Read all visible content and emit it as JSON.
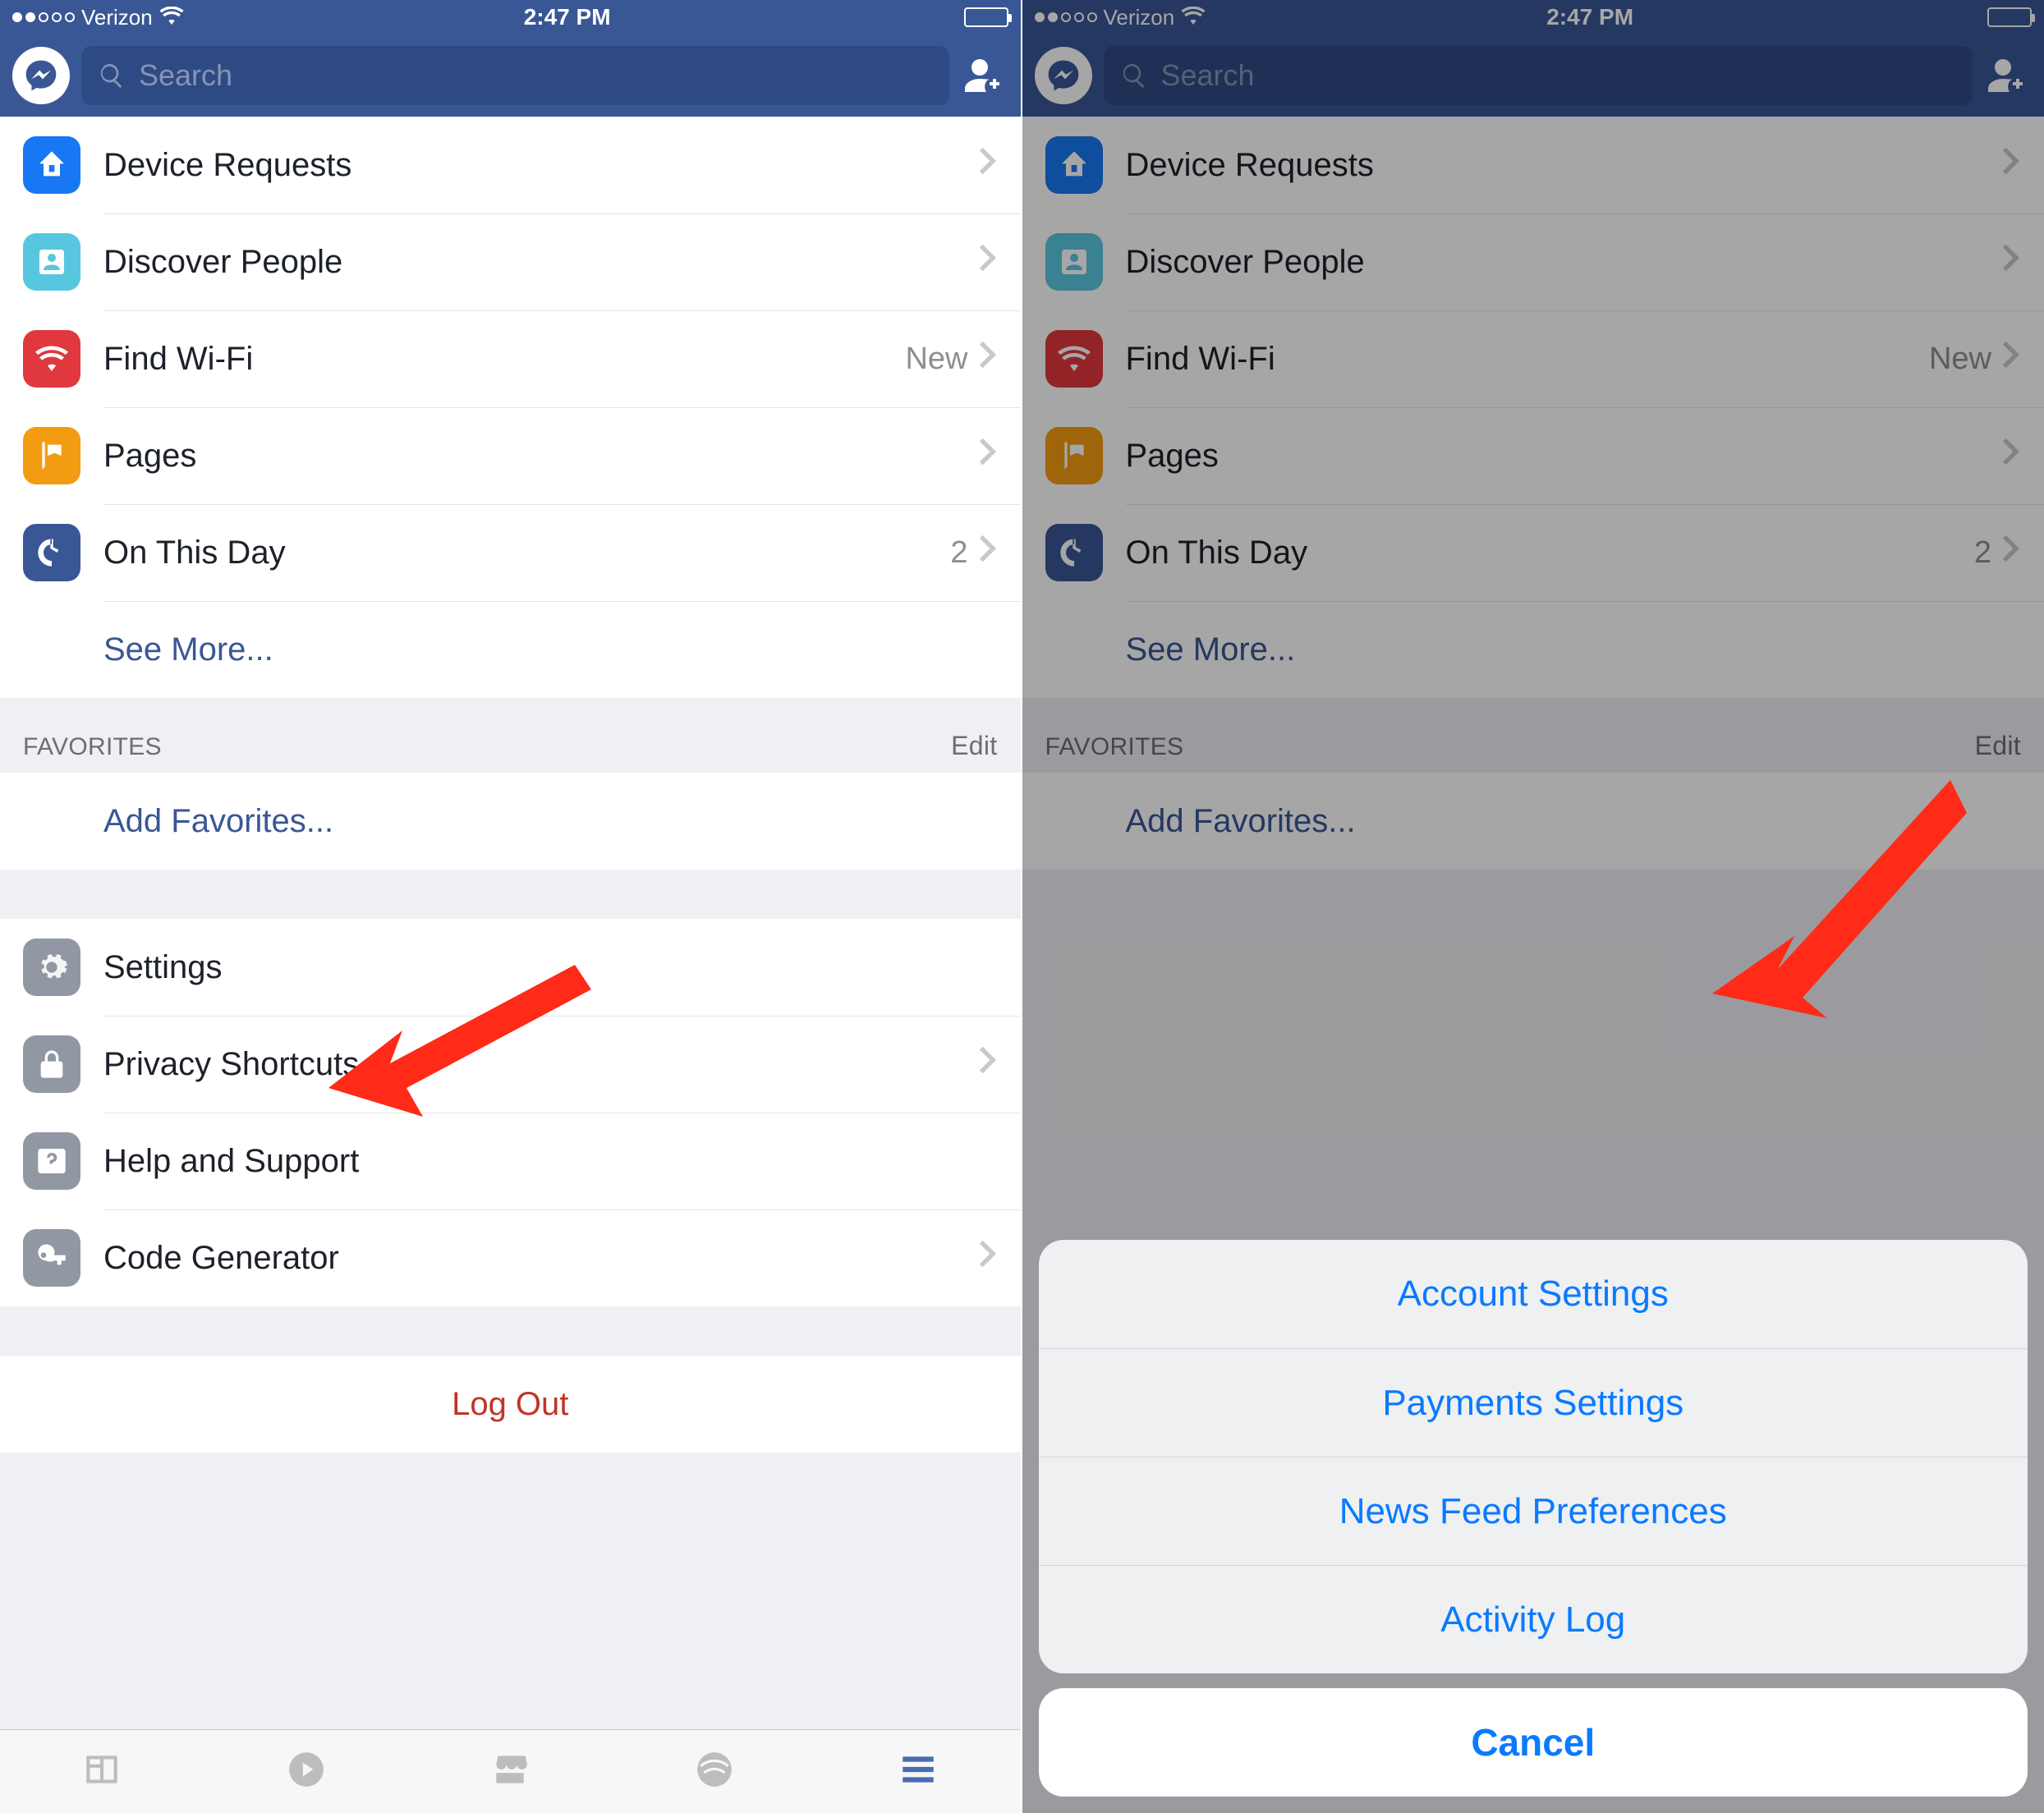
{
  "status": {
    "carrier": "Verizon",
    "time": "2:47 PM",
    "signal_filled": 2,
    "signal_total": 5
  },
  "search": {
    "placeholder": "Search"
  },
  "menu": {
    "items": [
      {
        "label": "Device Requests"
      },
      {
        "label": "Discover People"
      },
      {
        "label": "Find Wi-Fi",
        "badge": "New"
      },
      {
        "label": "Pages"
      },
      {
        "label": "On This Day",
        "badge": "2"
      }
    ],
    "see_more": "See More..."
  },
  "favorites": {
    "header": "FAVORITES",
    "edit": "Edit",
    "add": "Add Favorites..."
  },
  "settings": {
    "items": [
      {
        "label": "Settings",
        "chevron": false
      },
      {
        "label": "Privacy Shortcuts",
        "chevron": true
      },
      {
        "label": "Help and Support",
        "chevron": false
      },
      {
        "label": "Code Generator",
        "chevron": true
      }
    ]
  },
  "logout": "Log Out",
  "actionsheet": {
    "options": [
      "Account Settings",
      "Payments Settings",
      "News Feed Preferences",
      "Activity Log"
    ],
    "cancel": "Cancel"
  }
}
